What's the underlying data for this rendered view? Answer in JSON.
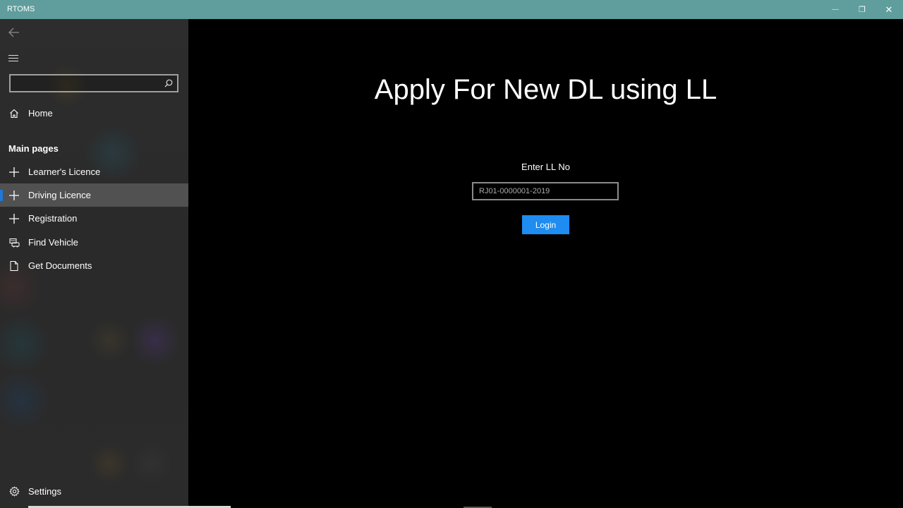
{
  "window": {
    "title": "RTOMS",
    "minimize_glyph": "—",
    "maximize_glyph": "❐",
    "close_glyph": "✕",
    "titlebar_color": "#5f9e9c"
  },
  "nav": {
    "search": {
      "value": "",
      "placeholder": ""
    },
    "home_label": "Home",
    "section_header": "Main pages",
    "items": [
      {
        "label": "Learner's Licence",
        "icon": "plus-icon",
        "selected": false
      },
      {
        "label": "Driving Licence",
        "icon": "plus-icon",
        "selected": true
      },
      {
        "label": "Registration",
        "icon": "plus-icon",
        "selected": false
      },
      {
        "label": "Find Vehicle",
        "icon": "vehicle-icon",
        "selected": false
      },
      {
        "label": "Get Documents",
        "icon": "document-icon",
        "selected": false
      }
    ],
    "settings_label": "Settings",
    "accent_color": "#1e78d7"
  },
  "main": {
    "title": "Apply For New DL using LL",
    "field_label": "Enter LL No",
    "ll_input": {
      "value": "",
      "placeholder": "RJ01-0000001-2019"
    },
    "login_label": "Login",
    "button_color": "#1e8cf0"
  }
}
